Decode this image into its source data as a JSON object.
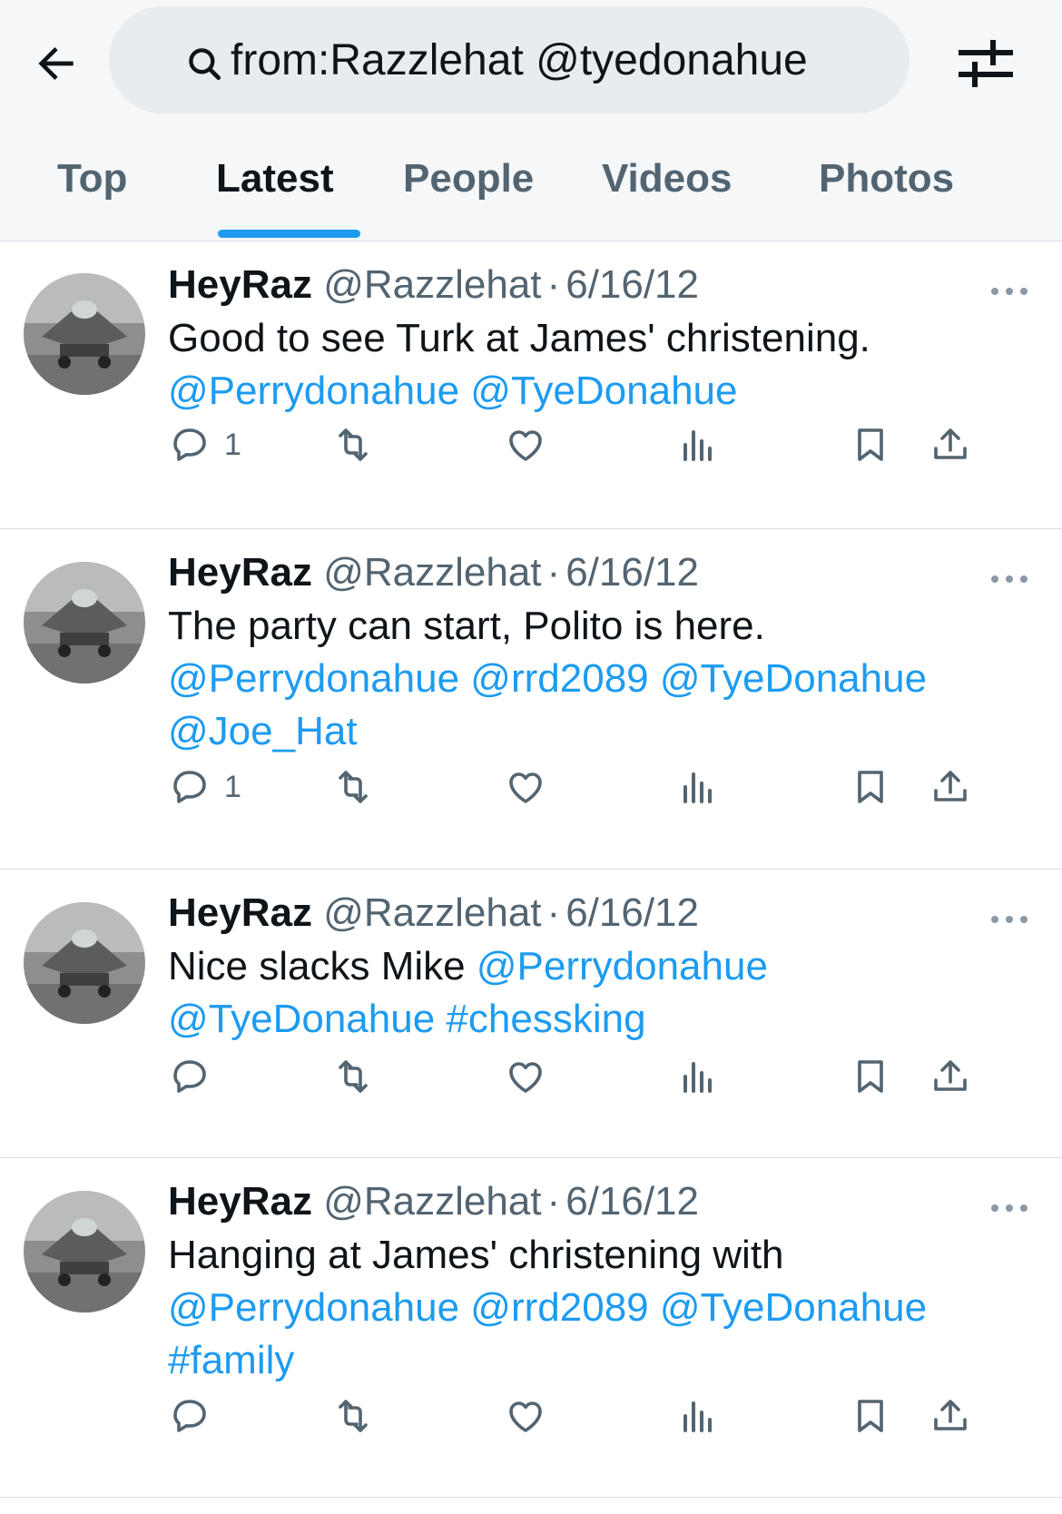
{
  "search": {
    "query": "from:Razzlehat @tyedonahue"
  },
  "icons": {
    "back": "arrow-left-icon",
    "search": "search-icon",
    "filter": "filter-sliders-icon",
    "reply": "reply-icon",
    "retweet": "retweet-icon",
    "like": "heart-icon",
    "views": "views-chart-icon",
    "bookmark": "bookmark-icon",
    "share": "share-icon",
    "more": "more-dots-icon"
  },
  "colors": {
    "accent": "#1d9bf0",
    "text_primary": "#0f1419",
    "text_secondary": "#536471"
  },
  "tabs": [
    {
      "label": "Top"
    },
    {
      "label": "Latest",
      "active": true
    },
    {
      "label": "People"
    },
    {
      "label": "Videos"
    },
    {
      "label": "Photos"
    }
  ],
  "tweets": [
    {
      "display_name": "HeyRaz",
      "handle": "@Razzlehat",
      "separator": "·",
      "date": "6/16/12",
      "text": "Good to see Turk at James' christening.",
      "links_line1": "",
      "links": [
        "@Perrydonahue @TyeDonahue"
      ],
      "reply_count": "1"
    },
    {
      "display_name": "HeyRaz",
      "handle": "@Razzlehat",
      "separator": "·",
      "date": "6/16/12",
      "text": "The party can start, Polito is here.",
      "links": [
        "@Perrydonahue @rrd2089 @TyeDonahue",
        "@Joe_Hat"
      ],
      "reply_count": "1"
    },
    {
      "display_name": "HeyRaz",
      "handle": "@Razzlehat",
      "separator": "·",
      "date": "6/16/12",
      "text": "Nice slacks Mike ",
      "inline_link": "@Perrydonahue",
      "links": [
        "@TyeDonahue #chessking"
      ],
      "reply_count": ""
    },
    {
      "display_name": "HeyRaz",
      "handle": "@Razzlehat",
      "separator": "·",
      "date": "6/16/12",
      "text": "Hanging at James' christening with",
      "links": [
        "@Perrydonahue @rrd2089 @TyeDonahue",
        "#family"
      ],
      "reply_count": ""
    }
  ]
}
